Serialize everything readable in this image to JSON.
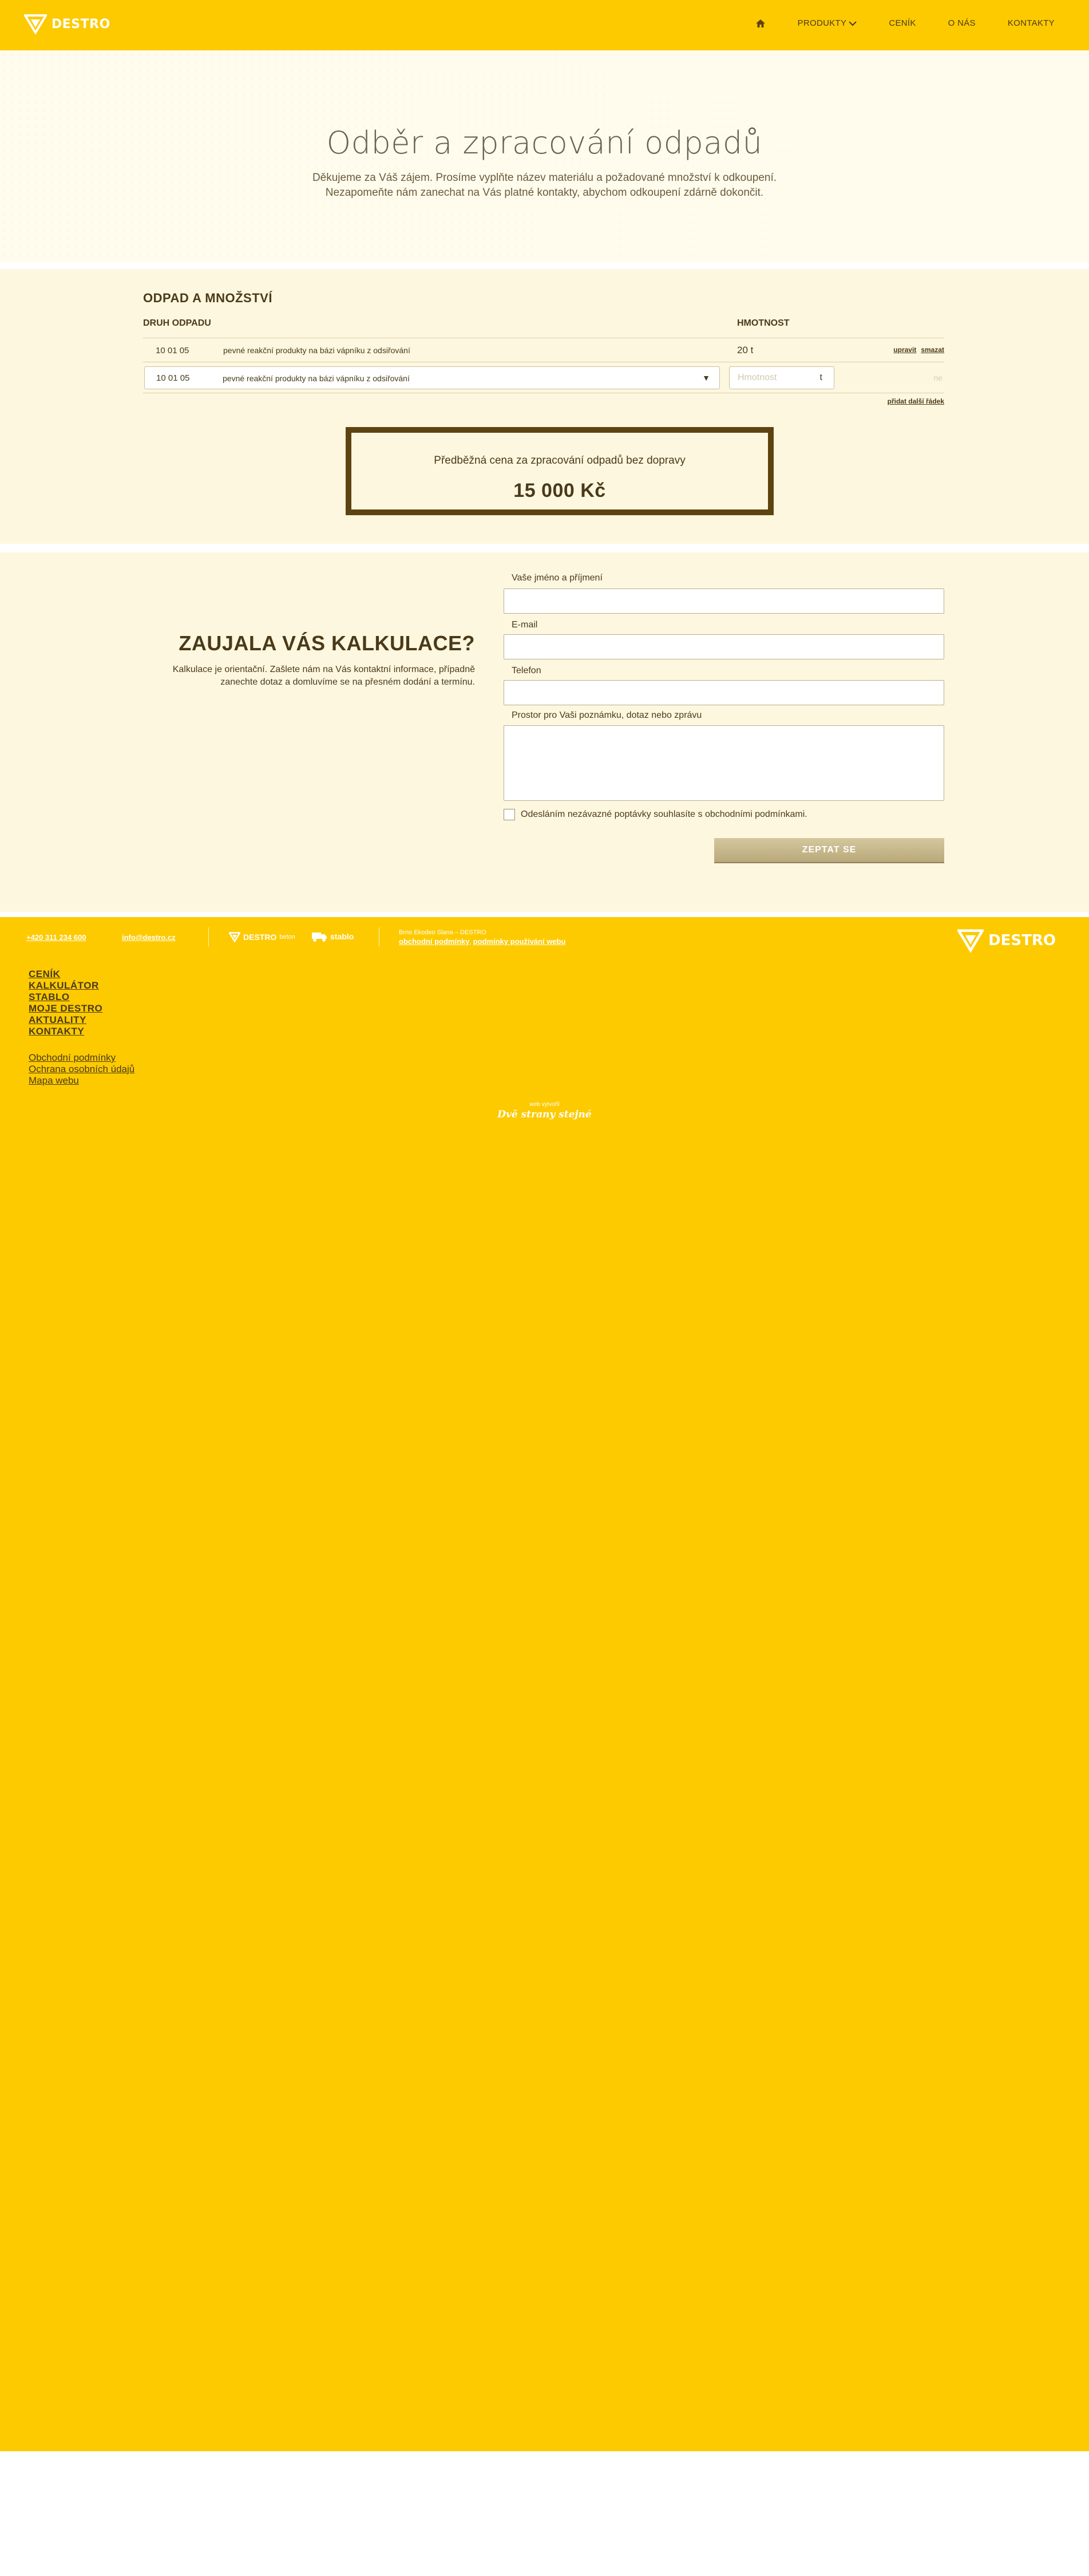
{
  "header": {
    "logo_text": "DESTRO",
    "nav": [
      {
        "label": "PRODUKTY"
      },
      {
        "label": "CENÍK"
      },
      {
        "label": "O NÁS"
      },
      {
        "label": "KONTAKTY"
      }
    ]
  },
  "hero": {
    "title": "Odběr a zpracování odpadů",
    "subtitle_line1": "Děkujeme za Váš zájem. Prosíme vyplňte název materiálu a požadované množství k odkoupení.",
    "subtitle_line2": "Nezapomeňte nám zanechat na Vás platné kontakty, abychom odkoupení zdárně dokončit."
  },
  "calculator": {
    "title": "ODPAD A MNOŽSTVÍ",
    "col_type": "DRUH ODPADU",
    "col_weight": "HMOTNOST",
    "rows": [
      {
        "code": "10 01 05",
        "name": "pevné reakční produkty na bázi vápníku z odsiřování",
        "weight": "20 t",
        "edit": "upravit",
        "delete": "smazat"
      }
    ],
    "new_row": {
      "code": "10 01 05",
      "name": "pevné reakční produkty na bázi vápníku z odsiřování",
      "weight_placeholder": "Hmotnost",
      "weight_unit": "t",
      "remove": "ne"
    },
    "add_row": "přidat další řádek",
    "price_label": "Předběžná cena za zpracování odpadů bez dopravy",
    "price_value": "15 000 Kč"
  },
  "inquiry": {
    "title": "ZAUJALA VÁS KALKULACE?",
    "text": "Kalkulace je orientační. Zašlete nám na Vás kontaktní informace, případně zanechte dotaz a domluvíme se na přesném dodání a termínu.",
    "fields": {
      "name": "Vaše jméno a příjmení",
      "email": "E-mail",
      "phone": "Telefon",
      "note": "Prostor pro Vaši poznámku, dotaz nebo zprávu"
    },
    "consent": "Odesláním nezávazné poptávky souhlasíte s obchodními podmínkami.",
    "submit": "ZEPTAT SE"
  },
  "footer": {
    "phone": "+420 311 234 600",
    "email": "info@destro.cz",
    "brand1": "DESTRO",
    "brand1_suffix": "beton",
    "brand2": "stablo",
    "copyright": "Brno Ekodeo Slana – DESTRO",
    "terms_link": "obchodní podmínky",
    "usage_link": "podmínky používání webu",
    "logo_text": "DESTRO",
    "menu": [
      "CENÍK",
      "KALKULÁTOR",
      "STABLO",
      "MOJE DESTRO",
      "AKTUALITY",
      "KONTAKTY"
    ],
    "submenu": [
      "Obchodní podmínky",
      "Ochrana osobních údajů",
      "Mapa webu"
    ],
    "credit_small": "web vytvořil",
    "credit_big": "Dvě strany stejné"
  }
}
